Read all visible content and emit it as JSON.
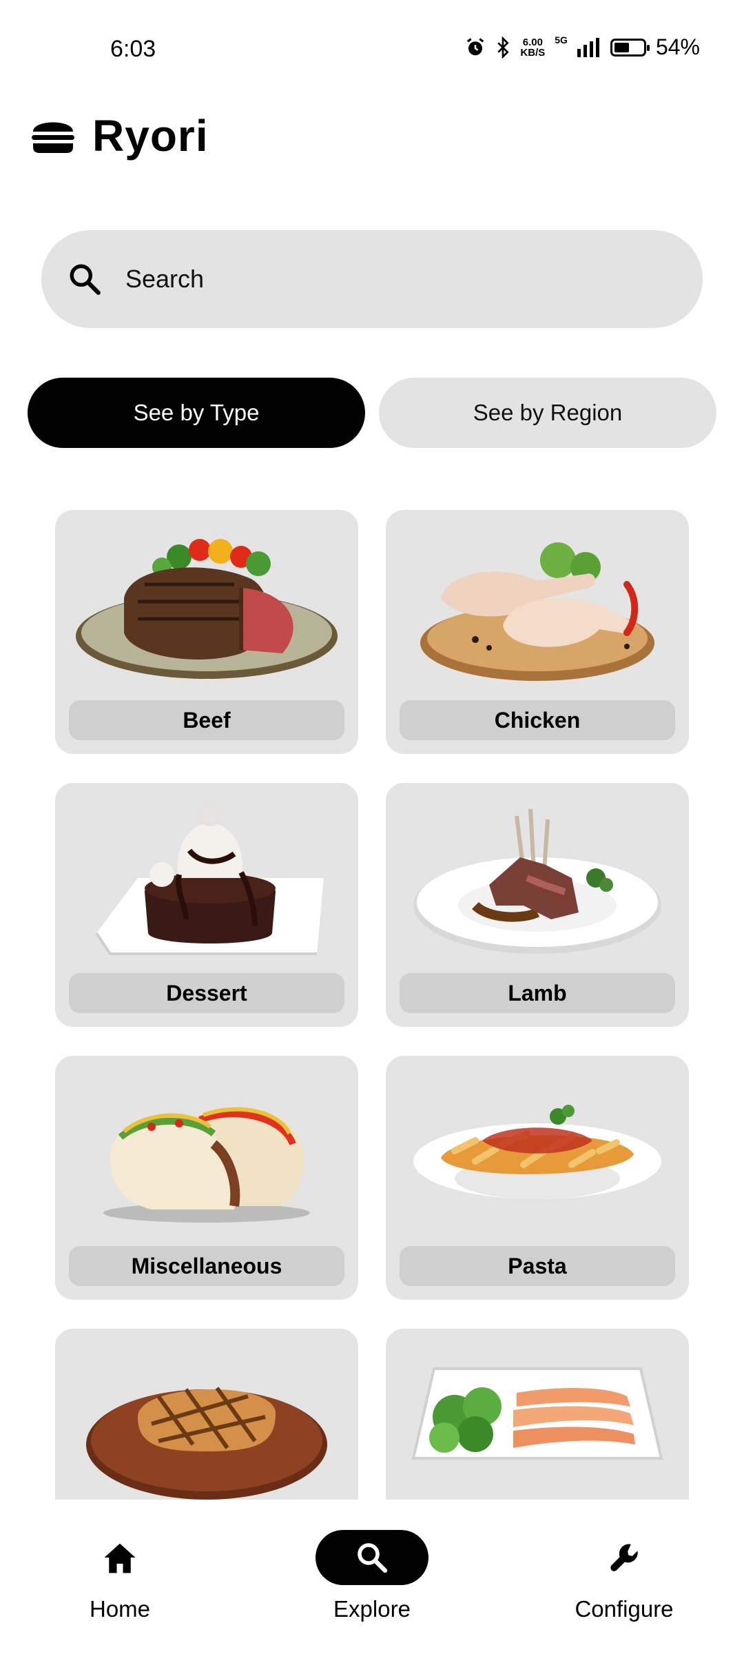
{
  "status_bar": {
    "time": "6:03",
    "network_speed_value": "6.00",
    "network_speed_unit": "KB/S",
    "network_type": "5G",
    "battery_percent": "54%",
    "battery_level": 0.54
  },
  "app": {
    "title": "Ryori",
    "logo_icon": "burger-icon"
  },
  "search": {
    "placeholder": "Search",
    "icon": "search-icon"
  },
  "view_toggle": {
    "by_type": "See by Type",
    "by_region": "See by Region",
    "selected": "by_type"
  },
  "categories": [
    {
      "label": "Beef",
      "image": "steak-plate"
    },
    {
      "label": "Chicken",
      "image": "chicken-legs"
    },
    {
      "label": "Dessert",
      "image": "chocolate-cake"
    },
    {
      "label": "Lamb",
      "image": "lamb-chops"
    },
    {
      "label": "Miscellaneous",
      "image": "tacos"
    },
    {
      "label": "Pasta",
      "image": "penne-pasta"
    },
    {
      "label": "",
      "image": "pork-chop"
    },
    {
      "label": "",
      "image": "salmon-salad"
    }
  ],
  "bottom_nav": [
    {
      "label": "Home",
      "icon": "home-icon"
    },
    {
      "label": "Explore",
      "icon": "search-icon",
      "active": true
    },
    {
      "label": "Configure",
      "icon": "wrench-icon"
    }
  ],
  "colors": {
    "accent": "#000000",
    "surface": "#e3e3e3",
    "card": "#e4e4e4",
    "label_bg": "#cfcfcf"
  }
}
